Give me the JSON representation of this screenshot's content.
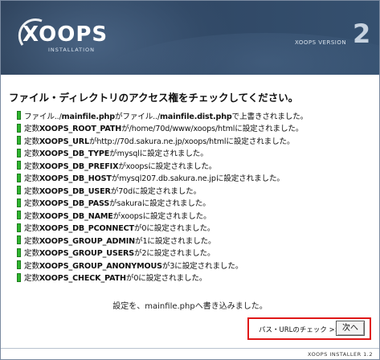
{
  "header": {
    "logo_text": "XOOPS",
    "logo_subtext": "INSTALLATION",
    "version_label": "XOOPS VERSION",
    "version_number": "2"
  },
  "title": "ファイル・ディレクトリのアクセス権をチェックしてください。",
  "log": [
    {
      "pre": "ファイル../",
      "key": "mainfile.php",
      "mid": "がファイル../",
      "key2": "mainfile.dist.php",
      "post": "で上書きされました。"
    },
    {
      "pre": "定数",
      "key": "XOOPS_ROOT_PATH",
      "mid": "が/home/70d/www/xoops/htmlに設定されました。"
    },
    {
      "pre": "定数",
      "key": "XOOPS_URL",
      "mid": "がhttp://70d.sakura.ne.jp/xoops/htmlに設定されました。"
    },
    {
      "pre": "定数",
      "key": "XOOPS_DB_TYPE",
      "mid": "がmysqlに設定されました。"
    },
    {
      "pre": "定数",
      "key": "XOOPS_DB_PREFIX",
      "mid": "がxoopsに設定されました。"
    },
    {
      "pre": "定数",
      "key": "XOOPS_DB_HOST",
      "mid": "がmysql207.db.sakura.ne.jpに設定されました。"
    },
    {
      "pre": "定数",
      "key": "XOOPS_DB_USER",
      "mid": "が70dに設定されました。"
    },
    {
      "pre": "定数",
      "key": "XOOPS_DB_PASS",
      "mid": "がsakuraに設定されました。"
    },
    {
      "pre": "定数",
      "key": "XOOPS_DB_NAME",
      "mid": "がxoopsに設定されました。"
    },
    {
      "pre": "定数",
      "key": "XOOPS_DB_PCONNECT",
      "mid": "が0に設定されました。"
    },
    {
      "pre": "定数",
      "key": "XOOPS_GROUP_ADMIN",
      "mid": "が1に設定されました。"
    },
    {
      "pre": "定数",
      "key": "XOOPS_GROUP_USERS",
      "mid": "が2に設定されました。"
    },
    {
      "pre": "定数",
      "key": "XOOPS_GROUP_ANONYMOUS",
      "mid": "が3に設定されました。"
    },
    {
      "pre": "定数",
      "key": "XOOPS_CHECK_PATH",
      "mid": "が0に設定されました。"
    }
  ],
  "bullet_color": "#2fb52f",
  "footer_message": "設定を、mainfile.phpへ書き込みました。",
  "nav": {
    "label": "パス・URLのチェック >>",
    "next_button": "次へ"
  },
  "highlight_color": "#e01818",
  "installer_version": "XOOPS INSTALLER 1.2"
}
